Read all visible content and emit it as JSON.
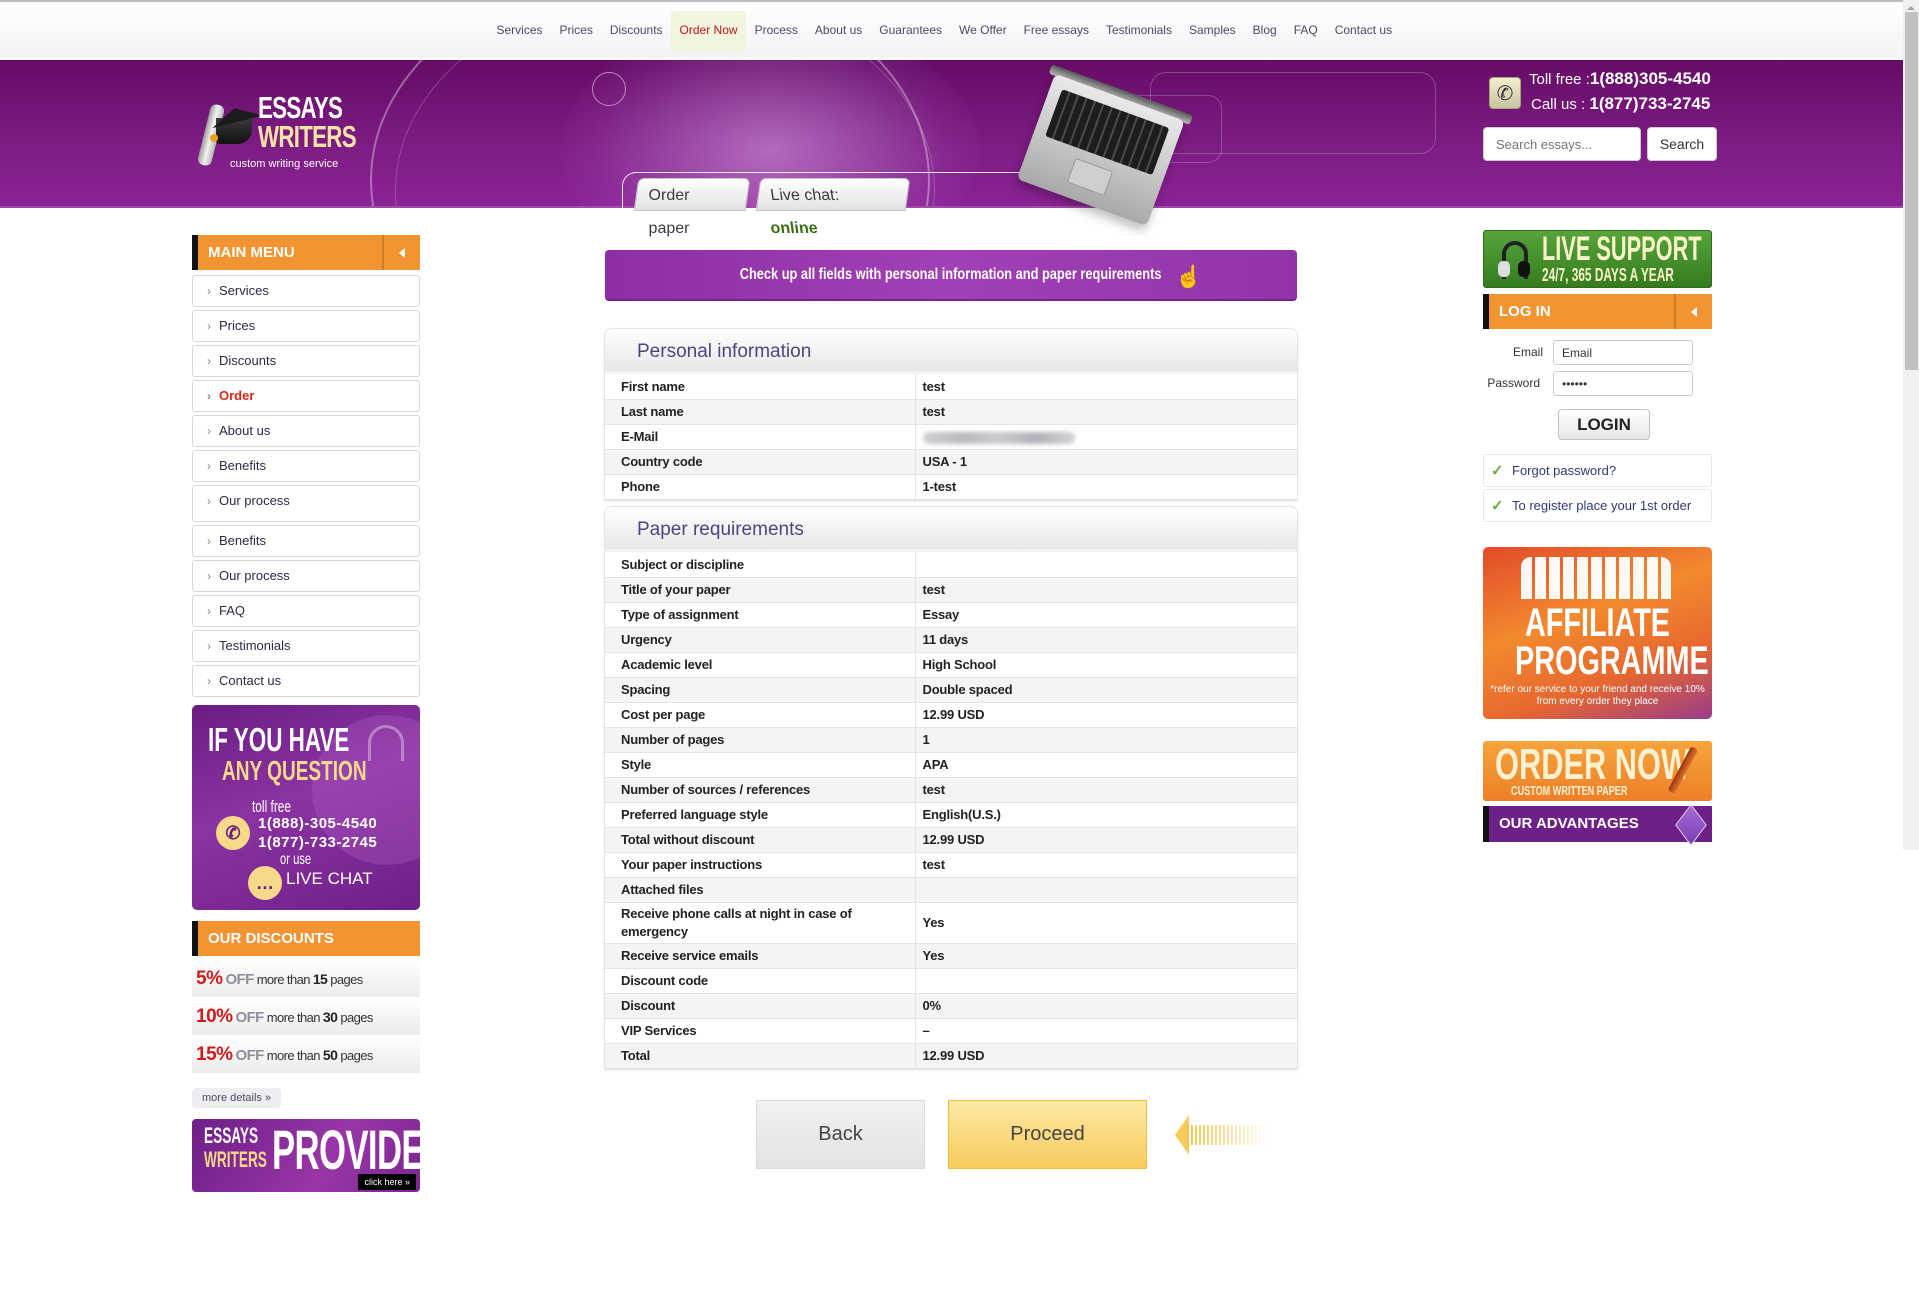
{
  "topnav": {
    "items": [
      {
        "label": "Services"
      },
      {
        "label": "Prices"
      },
      {
        "label": "Discounts"
      },
      {
        "label": "Order Now",
        "active": true
      },
      {
        "label": "Process"
      },
      {
        "label": "About us"
      },
      {
        "label": "Guarantees"
      },
      {
        "label": "We Offer"
      },
      {
        "label": "Free essays"
      },
      {
        "label": "Testimonials"
      },
      {
        "label": "Samples"
      },
      {
        "label": "Blog"
      },
      {
        "label": "FAQ"
      },
      {
        "label": "Contact us"
      }
    ]
  },
  "header": {
    "logo": {
      "line1": "ESSAYS",
      "line2": "WRITERS",
      "tagline": "custom writing service"
    },
    "tabs": {
      "order_paper": "Order paper",
      "live_chat_label": "Live chat:",
      "live_chat_status": "online"
    },
    "contact": {
      "toll_free_label": "Toll free :",
      "toll_free_number": "1(888)305-4540",
      "call_us_label": "Call us :",
      "call_us_number": "1(877)733-2745"
    },
    "search": {
      "placeholder": "Search essays...",
      "button": "Search"
    }
  },
  "left_sidebar": {
    "main_menu_title": "MAIN MENU",
    "menu": [
      {
        "label": "Services"
      },
      {
        "label": "Prices"
      },
      {
        "label": "Discounts"
      },
      {
        "label": "Order",
        "active": true
      },
      {
        "label": "About us"
      },
      {
        "label": "Benefits"
      },
      {
        "label": "Our process"
      },
      {
        "label": "Benefits"
      },
      {
        "label": "Our process"
      },
      {
        "label": "FAQ"
      },
      {
        "label": "Testimonials"
      },
      {
        "label": "Contact us"
      }
    ],
    "question_banner": {
      "line1": "IF YOU HAVE",
      "line2": "ANY QUESTION",
      "line3": "toll free",
      "phone1": "1(888)-305-4540",
      "phone2": "1(877)-733-2745",
      "line4": "or use",
      "chat": "LIVE CHAT"
    },
    "discounts_title": "OUR DISCOUNTS",
    "discounts": [
      {
        "pct": "5%",
        "off": "OFF",
        "text": "more than",
        "pages": "15",
        "unit": "pages"
      },
      {
        "pct": "10%",
        "off": "OFF",
        "text": "more than",
        "pages": "30",
        "unit": "pages"
      },
      {
        "pct": "15%",
        "off": "OFF",
        "text": "more than",
        "pages": "50",
        "unit": "pages"
      }
    ],
    "more_details": "more details »",
    "provide_banner": {
      "line1": "ESSAYS",
      "line2": "WRITERS",
      "big": "PROVIDE",
      "cta": "click here »"
    }
  },
  "main": {
    "notice": "Check up all fields with personal information and paper requirements",
    "personal": {
      "title": "Personal information",
      "rows": [
        {
          "label": "First name",
          "value": "test"
        },
        {
          "label": "Last name",
          "value": "test"
        },
        {
          "label": "E-Mail",
          "value": "",
          "blurred": true
        },
        {
          "label": "Country code",
          "value": "USA - 1"
        },
        {
          "label": "Phone",
          "value": "1-test"
        }
      ]
    },
    "paper": {
      "title": "Paper requirements",
      "rows": [
        {
          "label": "Subject or discipline",
          "value": ""
        },
        {
          "label": "Title of your paper",
          "value": "test"
        },
        {
          "label": "Type of assignment",
          "value": "Essay"
        },
        {
          "label": "Urgency",
          "value": "11 days"
        },
        {
          "label": "Academic level",
          "value": "High School"
        },
        {
          "label": "Spacing",
          "value": "Double spaced"
        },
        {
          "label": "Cost per page",
          "value": "12.99 USD"
        },
        {
          "label": "Number of pages",
          "value": "1"
        },
        {
          "label": "Style",
          "value": "APA"
        },
        {
          "label": "Number of sources / references",
          "value": "test"
        },
        {
          "label": "Preferred language style",
          "value": "English(U.S.)"
        },
        {
          "label": "Total without discount",
          "value": "12.99 USD"
        },
        {
          "label": "Your paper instructions",
          "value": "test"
        },
        {
          "label": "Attached files",
          "value": ""
        },
        {
          "label": "Receive phone calls at night in case of emergency",
          "value": "Yes",
          "tall": true
        },
        {
          "label": "Receive service emails",
          "value": "Yes"
        },
        {
          "label": "Discount code",
          "value": ""
        },
        {
          "label": "Discount",
          "value": "0%"
        },
        {
          "label": "VIP Services",
          "value": "–"
        },
        {
          "label": "Total",
          "value": "12.99 USD"
        }
      ]
    },
    "buttons": {
      "back": "Back",
      "proceed": "Proceed"
    }
  },
  "right_sidebar": {
    "live_support": {
      "line1": "LIVE SUPPORT",
      "line2": "24/7, 365 DAYS A YEAR"
    },
    "login": {
      "title": "LOG IN",
      "email_label": "Email",
      "email_value": "Email",
      "password_label": "Password",
      "password_value": "••••••",
      "button": "LOGIN"
    },
    "links": [
      {
        "label": "Forgot password?"
      },
      {
        "label": "To register place your 1st order"
      }
    ],
    "affiliate": {
      "line1": "AFFILIATE",
      "line2": "PROGRAMME",
      "note": "*refer our service to your friend and receive 10% from every order they place"
    },
    "order_now": {
      "line1": "ORDER NOW",
      "line2": "CUSTOM WRITTEN PAPER"
    },
    "advantages": "OUR ADVANTAGES"
  }
}
